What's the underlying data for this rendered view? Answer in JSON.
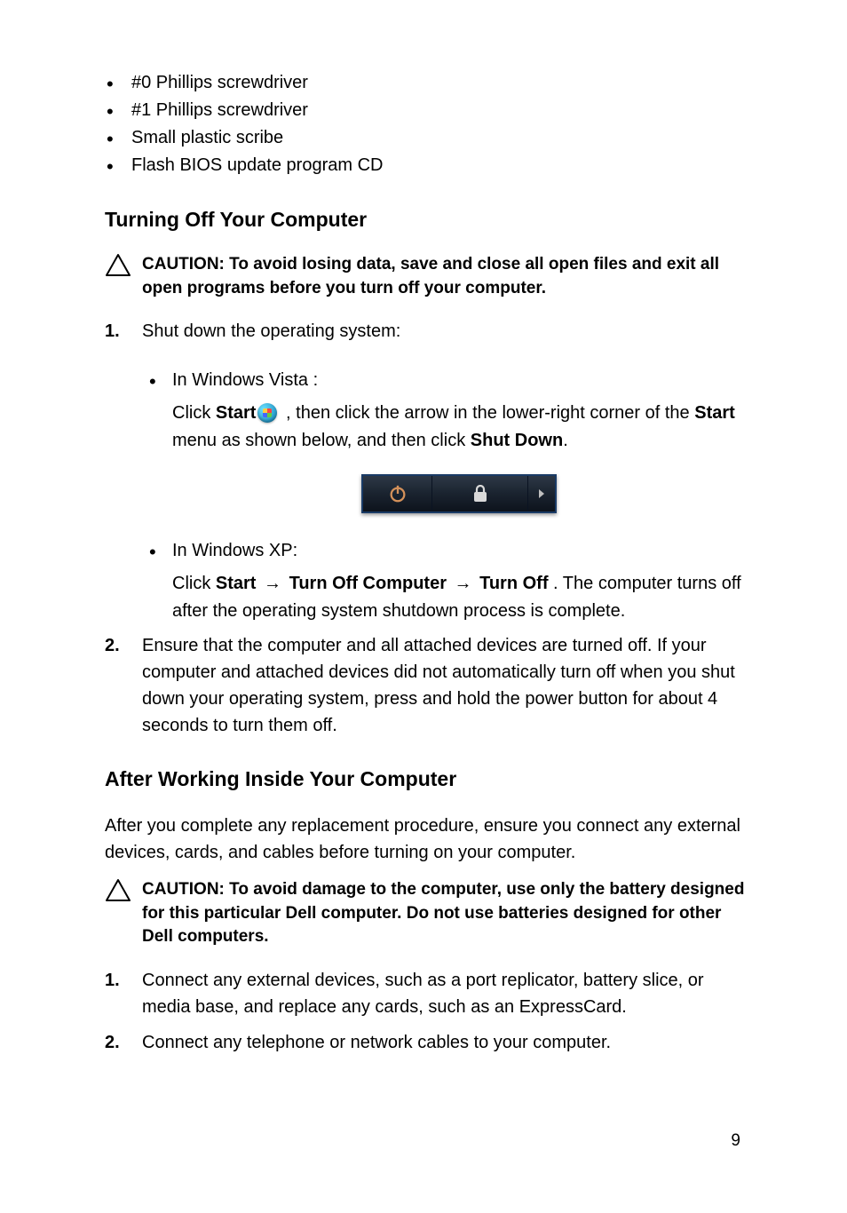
{
  "tools": {
    "items": [
      "#0 Phillips screwdriver",
      "#1 Phillips screwdriver",
      "Small plastic scribe",
      "Flash BIOS update program CD"
    ]
  },
  "section1": {
    "heading": "Turning Off Your Computer",
    "caution": "CAUTION: To avoid losing data, save and close all open files and exit all open programs before you turn off your computer.",
    "step1": {
      "num": "1.",
      "text": "Shut down the operating system:",
      "vista": {
        "label": "In Windows Vista :",
        "pre": "Click ",
        "start": "Start",
        "mid": " , then click the arrow in the lower-right corner of the ",
        "start2": "Start",
        "mid2": " menu as shown below, and then click ",
        "shutdown": "Shut Down",
        "end": "."
      },
      "xp": {
        "label": "In Windows XP:",
        "pre": "Click ",
        "start": "Start",
        "arrow1": " → ",
        "turnoffcomp": "Turn Off Computer",
        "arrow2": " → ",
        "turnoff": "Turn Off",
        "post": " . The computer turns off after the operating system shutdown process is complete."
      }
    },
    "step2": {
      "num": "2.",
      "text": "Ensure that the computer and all attached devices are turned off. If your computer and attached devices did not automatically turn off when you shut down your operating system, press and hold the power button for about 4 seconds to turn them off."
    }
  },
  "section2": {
    "heading": "After Working Inside Your Computer",
    "intro": "After you complete any replacement procedure, ensure you connect any external devices, cards, and cables before turning on your computer.",
    "caution": "CAUTION: To avoid damage to the computer, use only the battery designed for this particular Dell computer. Do not use batteries designed for other Dell computers.",
    "step1": {
      "num": "1.",
      "text": "Connect any external devices, such as a port replicator, battery slice, or media base, and replace any cards, such as an ExpressCard."
    },
    "step2": {
      "num": "2.",
      "text": "Connect any telephone or network cables to your computer."
    }
  },
  "page": "9"
}
